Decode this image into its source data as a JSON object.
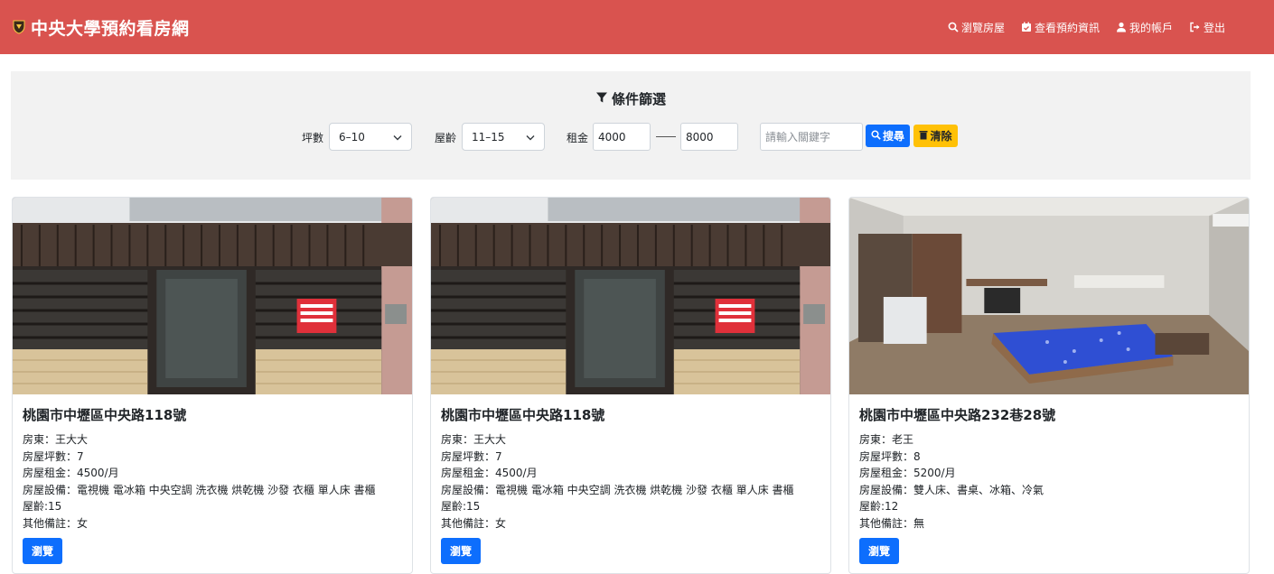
{
  "brand": {
    "title": "中央大學預約看房網"
  },
  "nav": {
    "browse": "瀏覽房屋",
    "reservations": "查看預約資訊",
    "account": "我的帳戶",
    "logout": "登出"
  },
  "filter": {
    "title": "條件篩選",
    "area_label": "坪數",
    "area_value": "6–10",
    "age_label": "屋齡",
    "age_value": "11–15",
    "rent_label": "租金",
    "rent_min": "4000",
    "rent_max": "8000",
    "keyword_placeholder": "請輸入關鍵字",
    "search_label": "搜尋",
    "clear_label": "清除"
  },
  "listings": [
    {
      "address": "桃園市中壢區中央路118號",
      "landlord": "房東：王大大",
      "area": "房屋坪數：7",
      "rent": "房屋租金：4500/月",
      "amenities": "房屋設備：電視機 電冰箱 中央空調 洗衣機 烘乾機 沙發 衣櫃 單人床 書櫃",
      "age": "屋齡:15",
      "notes": "其他備註：女",
      "button": "瀏覽"
    },
    {
      "address": "桃園市中壢區中央路118號",
      "landlord": "房東：王大大",
      "area": "房屋坪數：7",
      "rent": "房屋租金：4500/月",
      "amenities": "房屋設備：電視機 電冰箱 中央空調 洗衣機 烘乾機 沙發 衣櫃 單人床 書櫃",
      "age": "屋齡:15",
      "notes": "其他備註：女",
      "button": "瀏覽"
    },
    {
      "address": "桃園市中壢區中央路232巷28號",
      "landlord": "房東：老王",
      "area": "房屋坪數：8",
      "rent": "房屋租金：5200/月",
      "amenities": "房屋設備：雙人床、書桌、冰箱、冷氣",
      "age": "屋齡:12",
      "notes": "其他備註：無",
      "button": "瀏覽"
    }
  ],
  "colors": {
    "navbar": "#d9534f",
    "primary": "#0d6efd",
    "warning": "#ffc107",
    "filter_bg": "#f2f2f2"
  }
}
